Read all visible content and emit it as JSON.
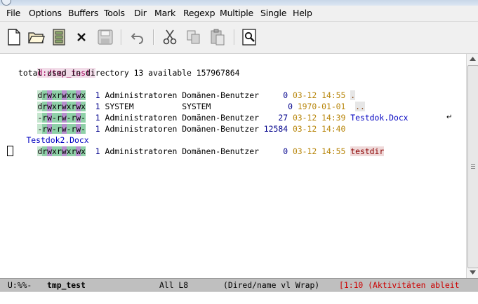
{
  "menu": {
    "items": [
      "File",
      "Options",
      "Buffers",
      "Tools",
      "Dir",
      "Mark",
      "Regexp",
      "Multiple",
      "Single",
      "Help"
    ]
  },
  "toolbar": {
    "buttons": [
      "new-file",
      "open-folder",
      "dired",
      "close",
      "save",
      "undo",
      "cut",
      "copy",
      "paste",
      "search"
    ]
  },
  "buffer": {
    "header": "d:/tmp_test:",
    "total_line": "total used in directory 13 available 157967864",
    "entries": [
      {
        "perm": "drwxrwxrwx",
        "links": "1",
        "owner": "Administratoren",
        "group": "Domänen-Benutzer",
        "size": "0",
        "date": "03-12 14:55",
        "name": "."
      },
      {
        "perm": "drwxrwxrwx",
        "links": "1",
        "owner": "SYSTEM",
        "group": "SYSTEM",
        "size": "0",
        "date": "1970-01-01",
        "name": ".."
      },
      {
        "perm": "-rw-rw-rw-",
        "links": "1",
        "owner": "Administratoren",
        "group": "Domänen-Benutzer",
        "size": "27",
        "date": "03-12 14:39",
        "name": "Testdok.Docx"
      },
      {
        "perm": "-rw-rw-rw-",
        "links": "1",
        "owner": "Administratoren",
        "group": "Domänen-Benutzer",
        "size": "12584",
        "date": "03-12 14:40",
        "name": "Testdok2.Docx"
      },
      {
        "perm": "drwxrwxrwx",
        "links": "1",
        "owner": "Administratoren",
        "group": "Domänen-Benutzer",
        "size": "0",
        "date": "03-12 14:55",
        "name": "testdir"
      }
    ]
  },
  "modeline": {
    "status": "U:%%-",
    "buffer_name": "tmp_test",
    "position": "All L8",
    "modes": "(Dired/name vl Wrap)",
    "message": "[1:10 (Aktivitäten ableit"
  },
  "colors": {
    "date": "#b8860b",
    "file_link": "#0000c0",
    "directory": "#8b0000",
    "modeline_bg": "#bfbfbf"
  }
}
